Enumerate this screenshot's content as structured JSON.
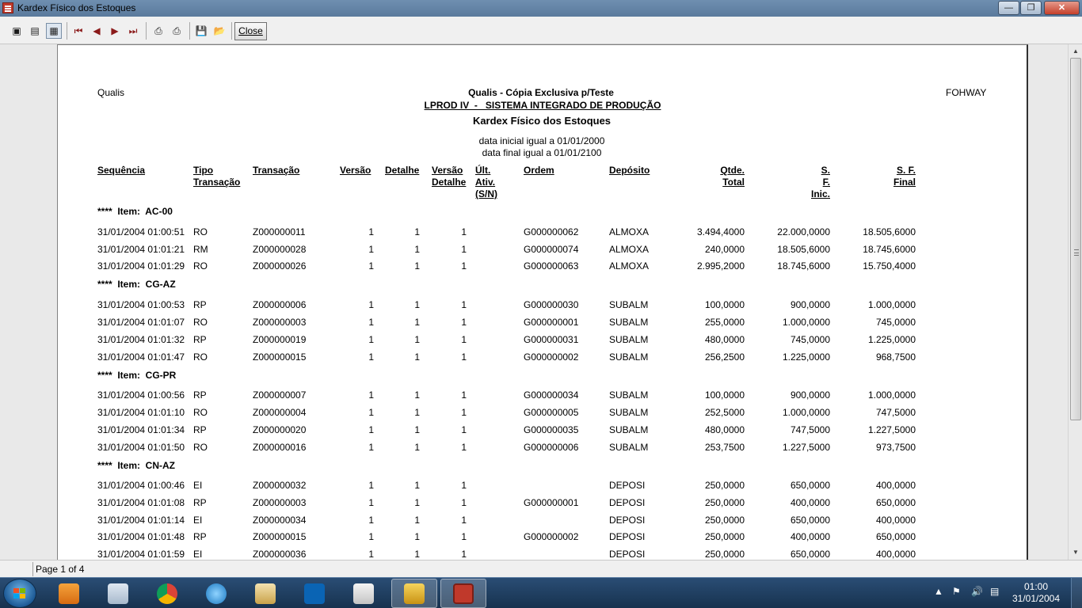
{
  "window": {
    "title": "Kardex Físico dos Estoques"
  },
  "toolbar": {
    "close_label": "Close"
  },
  "report": {
    "left_header": "Qualis",
    "company": "Qualis - Cópia Exclusiva p/Teste",
    "system": "LPROD IV  -   SISTEMA INTEGRADO DE PRODUÇÃO",
    "title": "Kardex Físico dos Estoques",
    "date_initial": "data inicial igual a 01/01/2000",
    "date_final": "data final igual a 01/01/2100",
    "right_header": "FOHWAY",
    "columns": {
      "sequencia": "Sequência",
      "tipo_transacao": "Tipo\nTransação",
      "transacao": "Transação",
      "versao": "Versão",
      "detalhe": "Detalhe",
      "versao_detalhe": "Versão\nDetalhe",
      "ult_ativ": "Últ.\nAtiv.\n(S/N)",
      "ordem": "Ordem",
      "deposito": "Depósito",
      "qtde_total": "Qtde.\nTotal",
      "sf_inic": "S.\nF.\nInic.",
      "sf_final": "S. F.\nFinal"
    },
    "groups": [
      {
        "label": "****  Item:  AC-00",
        "rows": [
          [
            "31/01/2004 01:00:51",
            "RO",
            "Z000000011",
            "1",
            "1",
            "1",
            "G000000062",
            "ALMOXA",
            "3.494,4000",
            "22.000,0000",
            "18.505,6000"
          ],
          [
            "31/01/2004 01:01:21",
            "RM",
            "Z000000028",
            "1",
            "1",
            "1",
            "G000000074",
            "ALMOXA",
            "240,0000",
            "18.505,6000",
            "18.745,6000"
          ],
          [
            "31/01/2004 01:01:29",
            "RO",
            "Z000000026",
            "1",
            "1",
            "1",
            "G000000063",
            "ALMOXA",
            "2.995,2000",
            "18.745,6000",
            "15.750,4000"
          ]
        ]
      },
      {
        "label": "****  Item:  CG-AZ",
        "rows": [
          [
            "31/01/2004 01:00:53",
            "RP",
            "Z000000006",
            "1",
            "1",
            "1",
            "G000000030",
            "SUBALM",
            "100,0000",
            "900,0000",
            "1.000,0000"
          ],
          [
            "31/01/2004 01:01:07",
            "RO",
            "Z000000003",
            "1",
            "1",
            "1",
            "G000000001",
            "SUBALM",
            "255,0000",
            "1.000,0000",
            "745,0000"
          ],
          [
            "31/01/2004 01:01:32",
            "RP",
            "Z000000019",
            "1",
            "1",
            "1",
            "G000000031",
            "SUBALM",
            "480,0000",
            "745,0000",
            "1.225,0000"
          ],
          [
            "31/01/2004 01:01:47",
            "RO",
            "Z000000015",
            "1",
            "1",
            "1",
            "G000000002",
            "SUBALM",
            "256,2500",
            "1.225,0000",
            "968,7500"
          ]
        ]
      },
      {
        "label": "****  Item:  CG-PR",
        "rows": [
          [
            "31/01/2004 01:00:56",
            "RP",
            "Z000000007",
            "1",
            "1",
            "1",
            "G000000034",
            "SUBALM",
            "100,0000",
            "900,0000",
            "1.000,0000"
          ],
          [
            "31/01/2004 01:01:10",
            "RO",
            "Z000000004",
            "1",
            "1",
            "1",
            "G000000005",
            "SUBALM",
            "252,5000",
            "1.000,0000",
            "747,5000"
          ],
          [
            "31/01/2004 01:01:34",
            "RP",
            "Z000000020",
            "1",
            "1",
            "1",
            "G000000035",
            "SUBALM",
            "480,0000",
            "747,5000",
            "1.227,5000"
          ],
          [
            "31/01/2004 01:01:50",
            "RO",
            "Z000000016",
            "1",
            "1",
            "1",
            "G000000006",
            "SUBALM",
            "253,7500",
            "1.227,5000",
            "973,7500"
          ]
        ]
      },
      {
        "label": "****  Item:  CN-AZ",
        "rows": [
          [
            "31/01/2004 01:00:46",
            "EI",
            "Z000000032",
            "1",
            "1",
            "1",
            "",
            "DEPOSI",
            "250,0000",
            "650,0000",
            "400,0000"
          ],
          [
            "31/01/2004 01:01:08",
            "RP",
            "Z000000003",
            "1",
            "1",
            "1",
            "G000000001",
            "DEPOSI",
            "250,0000",
            "400,0000",
            "650,0000"
          ],
          [
            "31/01/2004 01:01:14",
            "EI",
            "Z000000034",
            "1",
            "1",
            "1",
            "",
            "DEPOSI",
            "250,0000",
            "650,0000",
            "400,0000"
          ],
          [
            "31/01/2004 01:01:48",
            "RP",
            "Z000000015",
            "1",
            "1",
            "1",
            "G000000002",
            "DEPOSI",
            "250,0000",
            "400,0000",
            "650,0000"
          ],
          [
            "31/01/2004 01:01:59",
            "EI",
            "Z000000036",
            "1",
            "1",
            "1",
            "",
            "DEPOSI",
            "250,0000",
            "650,0000",
            "400,0000"
          ]
        ]
      }
    ]
  },
  "status": {
    "page": "Page 1 of 4"
  },
  "taskbar": {
    "time": "01:00",
    "date": "31/01/2004",
    "apps": [
      "windows-media-player-icon",
      "calculator-icon",
      "chrome-icon",
      "internet-explorer-icon",
      "mail-icon",
      "outlook-icon",
      "snipping-tool-icon",
      "app-7-icon",
      "kardex-app-icon"
    ]
  }
}
